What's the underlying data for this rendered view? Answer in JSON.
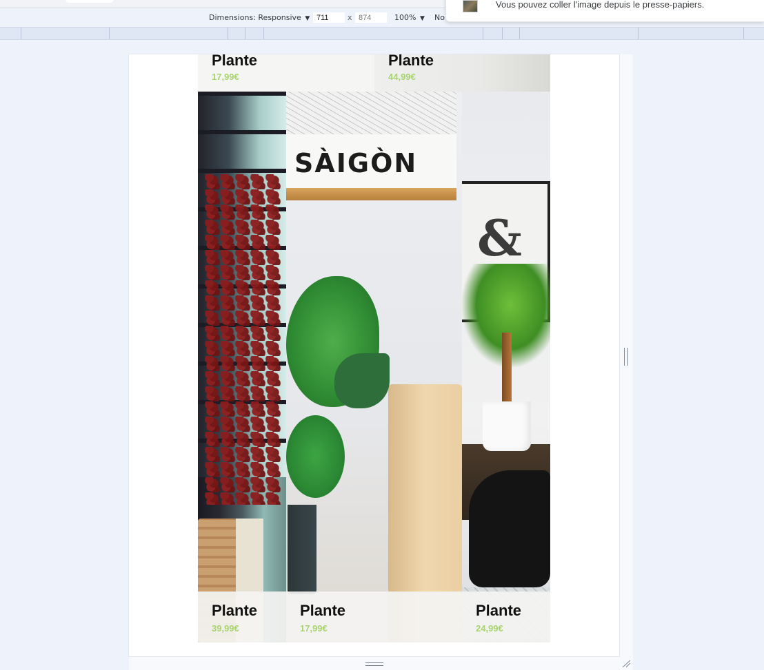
{
  "devtools": {
    "dimensions_label": "Dimensions: Responsive",
    "width_value": "711",
    "height_value": "874",
    "x_sep": "x",
    "zoom": "100%",
    "throttle_label": "No"
  },
  "notification": {
    "text": "Vous pouvez coller l'image depuis le presse-papiers."
  },
  "page": {
    "top_cards": [
      {
        "name": "Plante",
        "price": "17,99€"
      },
      {
        "name": "Plante",
        "price": "44,99€"
      }
    ],
    "photo_texts": {
      "poster": "SÀIGÒN",
      "frame_symbol": "&"
    },
    "bottom_cards": [
      {
        "name": "Plante",
        "price": "39,99€"
      },
      {
        "name": "Plante",
        "price": "17,99€"
      },
      {
        "name": "Plante",
        "price": "24,99€"
      }
    ]
  },
  "colors": {
    "price": "#a7d46f",
    "caption_bg": "#f4f4f2"
  }
}
